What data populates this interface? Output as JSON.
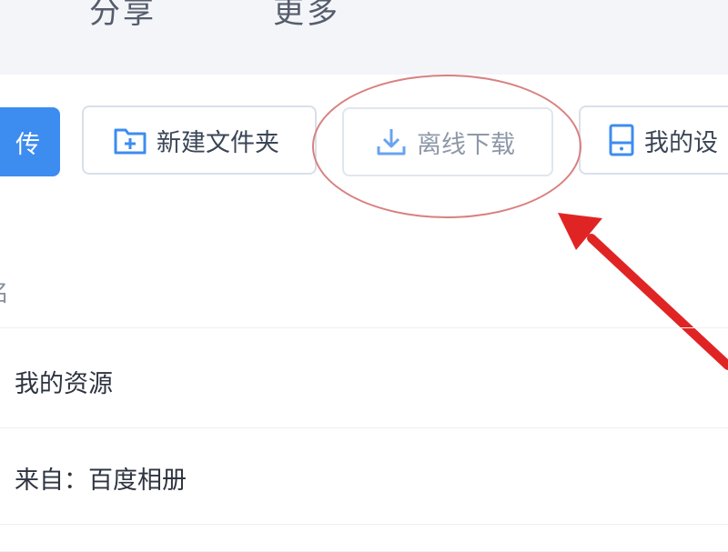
{
  "topnav": {
    "items": [
      {
        "label": "分享"
      },
      {
        "label": "更多"
      }
    ]
  },
  "toolbar": {
    "upload_label": "传",
    "new_folder_label": "新建文件夹",
    "offline_download_label": "离线下载",
    "my_device_label": "我的设"
  },
  "list": {
    "header_name": "名",
    "rows": [
      {
        "label": "我的资源"
      },
      {
        "label": "来自：百度相册"
      }
    ]
  },
  "colors": {
    "primary": "#3d8cf0",
    "annotation": "#e02424",
    "disabled_text": "#8e98a8"
  },
  "icons": {
    "new_folder": "folder-plus-icon",
    "offline_download": "download-icon",
    "my_device": "device-icon"
  }
}
